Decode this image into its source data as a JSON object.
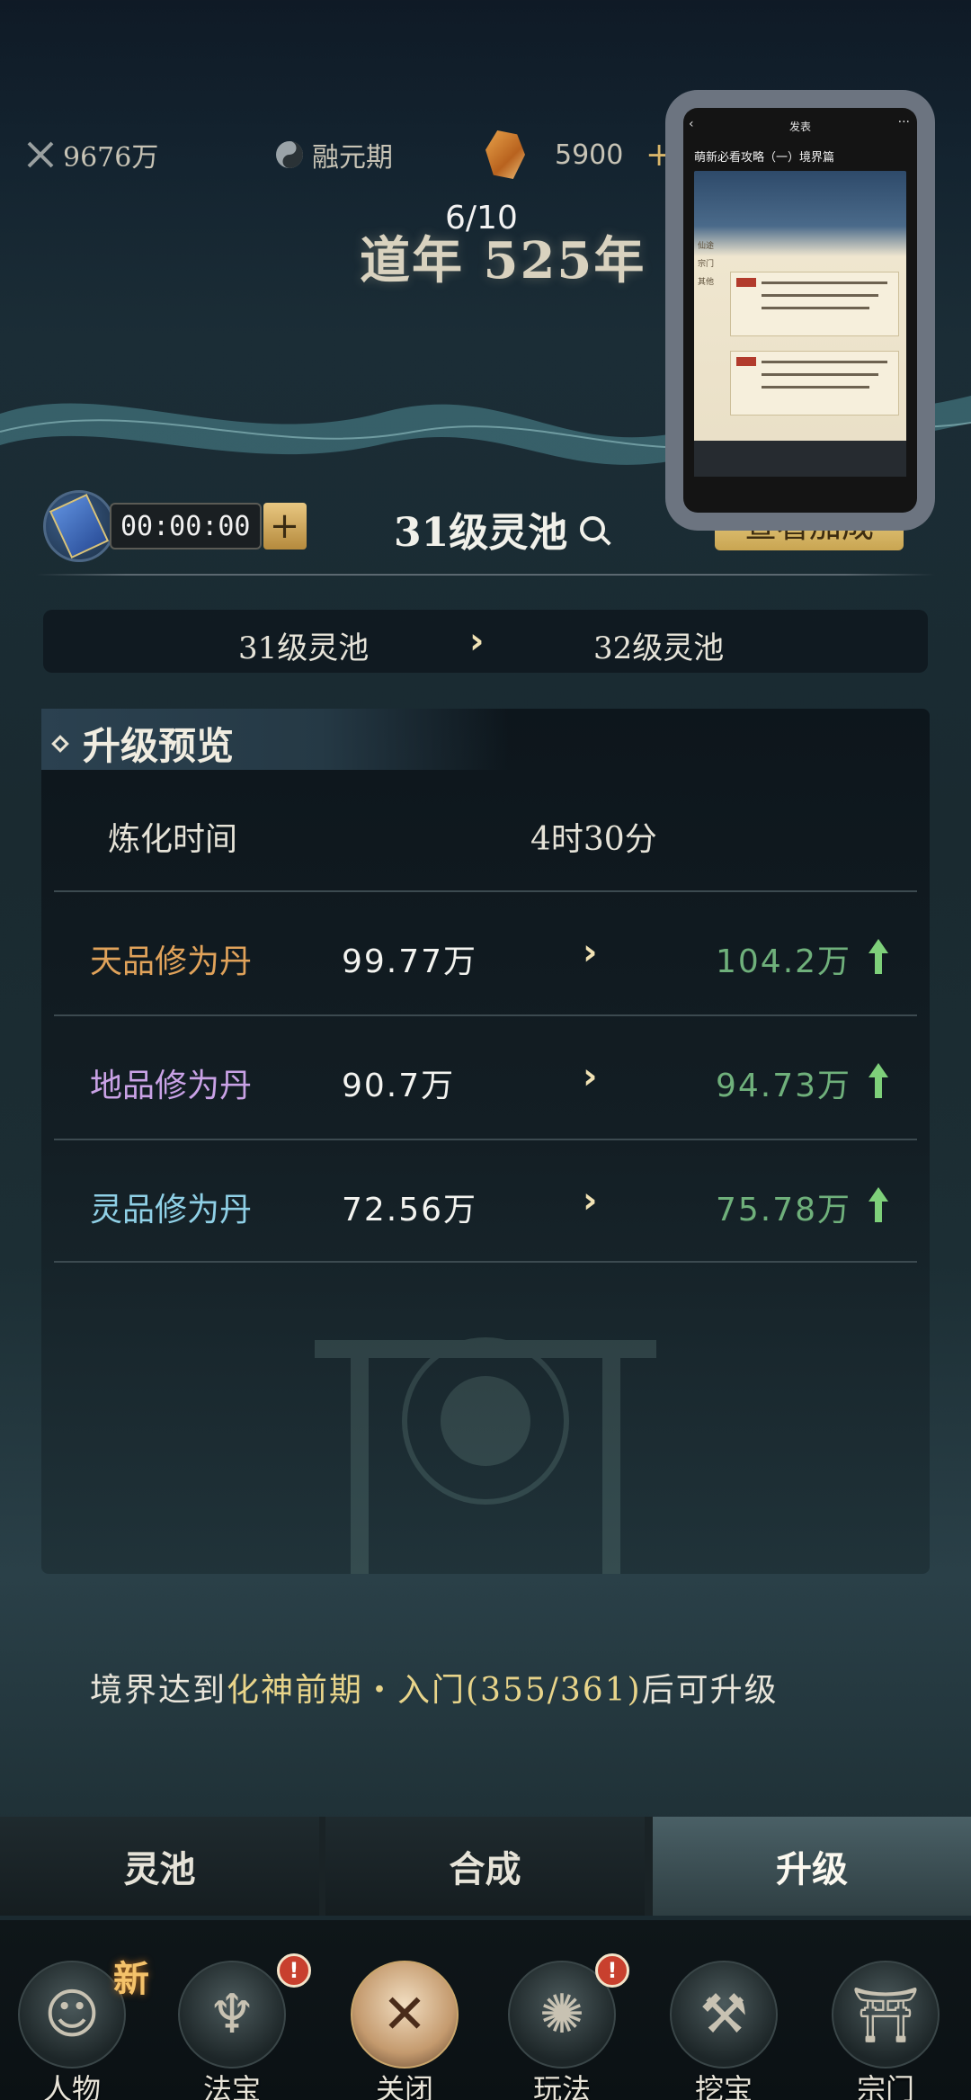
{
  "resources": {
    "power": "9676万",
    "realm": "融元期",
    "crystals": "5900",
    "add": "+"
  },
  "era": {
    "counter": "6/10",
    "title": "道年 525年"
  },
  "pool": {
    "timer": "00:00:00",
    "timer_add": "+",
    "title": "31级灵池",
    "view_bonus": "查看加成"
  },
  "compare": {
    "from": "31级灵池",
    "arrow": "›",
    "to": "32级灵池"
  },
  "preview": {
    "title": "升级预览",
    "refine_label": "炼化时间",
    "refine_value": "4时30分",
    "rows": [
      {
        "name": "天品修为丹",
        "color": "#e0a25a",
        "from": "99.77万",
        "to": "104.2万"
      },
      {
        "name": "地品修为丹",
        "color": "#c9a2e6",
        "from": "90.7万",
        "to": "94.73万"
      },
      {
        "name": "灵品修为丹",
        "color": "#8fd0e6",
        "from": "72.56万",
        "to": "75.78万"
      }
    ]
  },
  "requirement": {
    "prefix": "境界达到",
    "target": "化神前期・入门(355/361)",
    "suffix": "后可升级"
  },
  "subtabs": [
    "灵池",
    "合成",
    "升级"
  ],
  "nav": {
    "items": [
      "人物",
      "法宝",
      "关闭",
      "玩法",
      "挖宝",
      "宗门"
    ],
    "new_badge": "新",
    "alert": "!"
  },
  "floating_preview": {
    "header": "发表",
    "back": "‹",
    "more": "···",
    "article_title": "萌新必看攻略（一）境界篇",
    "side_items": [
      "仙途",
      "宗门",
      "其他"
    ]
  },
  "colors": {
    "accent_gold": "#e8d48a",
    "increase_green": "#6fb07b",
    "badge_red": "#c8402e"
  }
}
